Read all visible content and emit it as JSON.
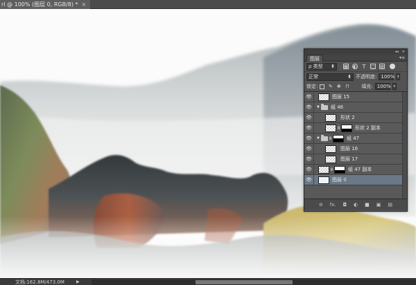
{
  "document": {
    "tab_title": "rl @ 100% (图层 0, RGB/8) *",
    "close_glyph": "×"
  },
  "status_bar": {
    "doc_info": "文档:162.8M/473.0M",
    "arrow": "▶"
  },
  "layers_panel": {
    "title": "图层",
    "collapse_glyph": "◂◂",
    "close_glyph": "×",
    "menu_glyph": "▾≡",
    "filter": {
      "kind_label": "ρ 类型",
      "icons": [
        "image-filter-icon",
        "adjustment-filter-icon",
        "type-filter-icon",
        "shape-filter-icon",
        "smart-object-filter-icon"
      ],
      "type_glyph": "T"
    },
    "blend_mode": "正常",
    "opacity_label": "不透明度:",
    "opacity_value": "100%",
    "lock_label": "锁定:",
    "fill_label": "填充:",
    "fill_value": "100%",
    "layers": [
      {
        "name": "图层 15",
        "type": "pixel",
        "indent": 0
      },
      {
        "name": "组 46",
        "type": "group",
        "indent": 0
      },
      {
        "name": "形状 2",
        "type": "pixel",
        "indent": 1
      },
      {
        "name": "形状 2 副本",
        "type": "masked",
        "indent": 1
      },
      {
        "name": "组 47",
        "type": "group-masked",
        "indent": 0
      },
      {
        "name": "图层 16",
        "type": "pixel",
        "indent": 1
      },
      {
        "name": "图层 17",
        "type": "pixel",
        "indent": 1
      },
      {
        "name": "组 47 副本",
        "type": "masked",
        "indent": 0
      },
      {
        "name": "图层 0",
        "type": "selected",
        "indent": 0
      }
    ],
    "footer_icons": [
      "link-icon",
      "fx-icon",
      "mask-icon",
      "adjustment-icon",
      "group-folder-icon",
      "new-layer-icon",
      "trash-icon"
    ],
    "footer_glyphs": {
      "link": "⊖",
      "fx": "fx.",
      "mask": "◘",
      "adjust": "◐",
      "group": "■",
      "new": "▣",
      "trash": "▤"
    }
  },
  "colors": {
    "ui_gray": "#535353",
    "selected_layer": "#6b7886",
    "canvas_bg": "#fbfbfb"
  }
}
